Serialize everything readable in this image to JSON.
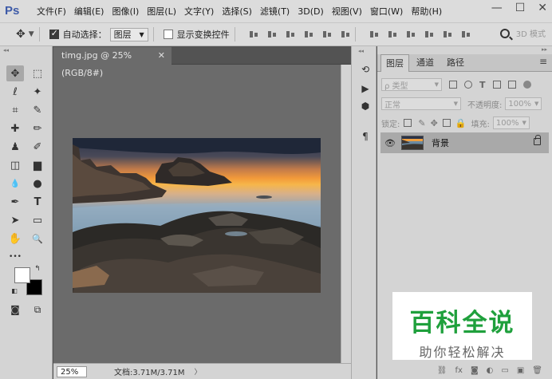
{
  "app": {
    "logo": "Ps"
  },
  "menu": [
    "文件(F)",
    "编辑(E)",
    "图像(I)",
    "图层(L)",
    "文字(Y)",
    "选择(S)",
    "滤镜(T)",
    "3D(D)",
    "视图(V)",
    "窗口(W)",
    "帮助(H)"
  ],
  "window_controls": {
    "minimize": "—",
    "maximize": "☐",
    "close": "✕"
  },
  "options_bar": {
    "move_glyph": "✥",
    "auto_select_label": "自动选择：",
    "auto_select_checked": true,
    "target_value": "图层",
    "show_transform_label": "显示变换控件",
    "show_transform_checked": false,
    "mode_3d": "3D 模式"
  },
  "toolbox": {
    "icons": [
      "move-icon",
      "rect-marquee-icon",
      "lasso-icon",
      "magic-wand-icon",
      "crop-icon",
      "eyedropper-icon",
      "healing-brush-icon",
      "brush-icon",
      "clone-stamp-icon",
      "history-brush-icon",
      "eraser-icon",
      "gradient-icon",
      "blur-icon",
      "dodge-icon",
      "pen-icon",
      "type-icon",
      "path-select-icon",
      "rectangle-shape-icon",
      "hand-icon",
      "zoom-icon",
      "more-tools-icon"
    ],
    "glyphs": [
      "✥",
      "⬚",
      "ℓ",
      "✦",
      "⌗",
      "✎",
      "✚",
      "✏",
      "♟",
      "✐",
      "◫",
      "▆",
      "💧",
      "●",
      "✒",
      "T",
      "➤",
      "▭",
      "✋",
      "🔍",
      "•••"
    ],
    "foreground_color": "#ffffff",
    "background_color": "#000000"
  },
  "document": {
    "tab_title": "timg.jpg @ 25%(RGB/8#)",
    "close_glyph": "✕",
    "zoom": "25%",
    "doc_info": "文档:3.71M/3.71M",
    "arrow_glyph": "〉"
  },
  "panel_strip": {
    "icons": [
      "history-icon",
      "play-action-icon",
      "cube-3d-icon",
      "paragraph-icon"
    ],
    "glyphs": [
      "⟲",
      "▶",
      "⬢",
      "¶"
    ]
  },
  "layers_panel": {
    "tabs": [
      "图层",
      "通道",
      "路径"
    ],
    "active_tab": 0,
    "menu_glyph": "≡",
    "filter_kind": "ρ 类型",
    "blend_mode": "正常",
    "opacity_label": "不透明度:",
    "opacity_value": "100%",
    "lock_label": "锁定:",
    "fill_label": "填充:",
    "fill_value": "100%",
    "layers": [
      {
        "name": "背景",
        "visible": true,
        "locked": true
      }
    ],
    "bottom_icons": [
      "link-icon",
      "fx-icon",
      "mask-icon",
      "adjustment-icon",
      "group-icon",
      "new-layer-icon",
      "trash-icon"
    ],
    "bottom_glyphs": [
      "⛓",
      "fx",
      "◙",
      "◐",
      "▭",
      "▣",
      "🗑"
    ]
  },
  "watermark": {
    "title": "百科全说",
    "subtitle": "助你轻松解决",
    "title_color": "#1fa03c"
  }
}
